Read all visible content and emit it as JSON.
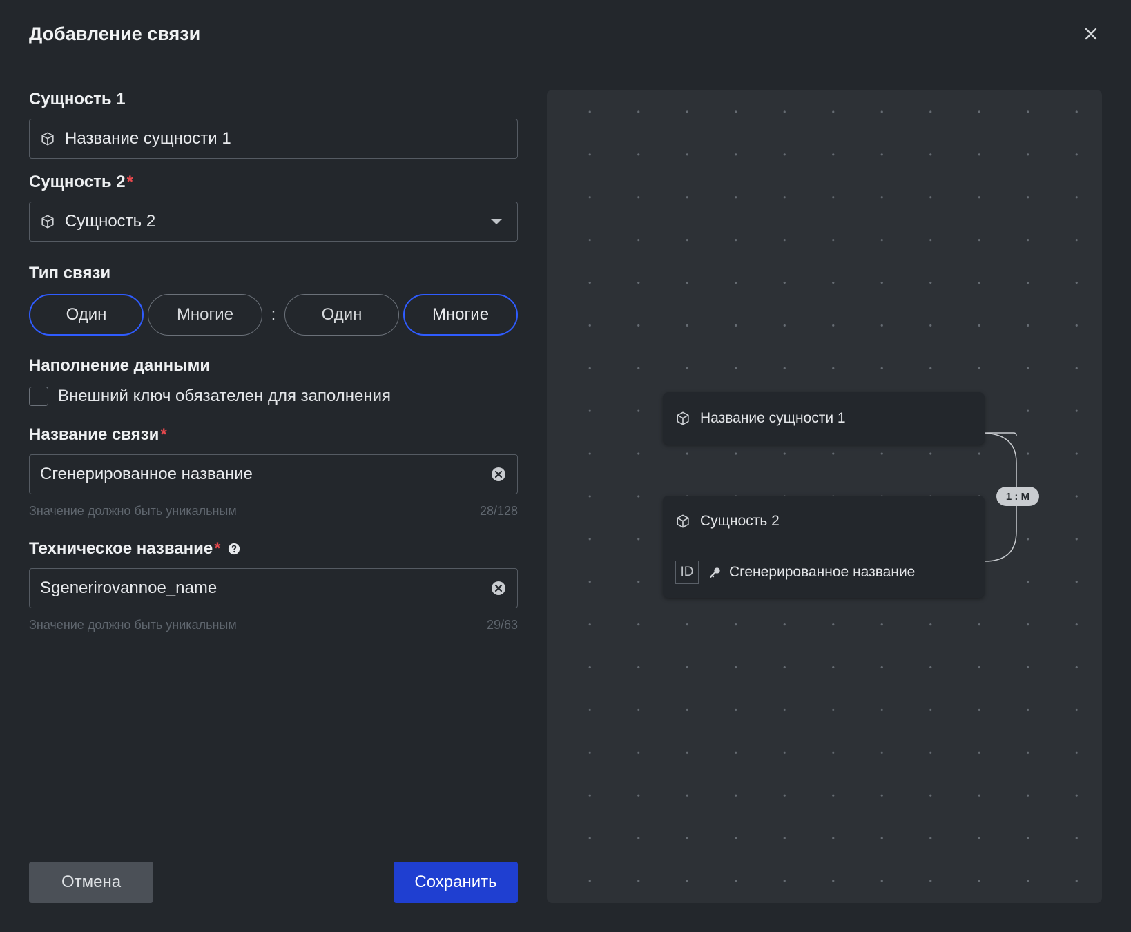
{
  "header": {
    "title": "Добавление связи"
  },
  "entity1": {
    "label": "Сущность 1",
    "value": "Название сущности 1"
  },
  "entity2": {
    "label": "Сущность 2",
    "required": "*",
    "value": "Сущность 2"
  },
  "relation_type": {
    "label": "Тип связи",
    "left_options": [
      "Один",
      "Многие"
    ],
    "right_options": [
      "Один",
      "Многие"
    ],
    "separator": ":",
    "left_selected": "Один",
    "right_selected": "Многие"
  },
  "data_fill": {
    "label": "Наполнение данными",
    "checkbox_label": "Внешний ключ обязателен для заполнения",
    "checked": false
  },
  "relation_name": {
    "label": "Название связи",
    "required": "*",
    "value": "Сгенерированное название",
    "hint": "Значение должно быть уникальным",
    "counter": "28/128"
  },
  "technical_name": {
    "label": "Техническое название",
    "required": "*",
    "value": "Sgenerirovannoe_name",
    "hint": "Значение должно быть уникальным",
    "counter": "29/63"
  },
  "footer": {
    "cancel_label": "Отмена",
    "save_label": "Сохранить"
  },
  "diagram": {
    "node1": {
      "title": "Название сущности 1"
    },
    "node2": {
      "title": "Сущность 2",
      "field_badge": "ID",
      "field_name": "Сгенерированное название"
    },
    "relation_label": "1 : M"
  },
  "colors": {
    "accent": "#2f5cff",
    "primary_button": "#1f3fd1",
    "required": "#e5484d",
    "background": "#23272c"
  }
}
